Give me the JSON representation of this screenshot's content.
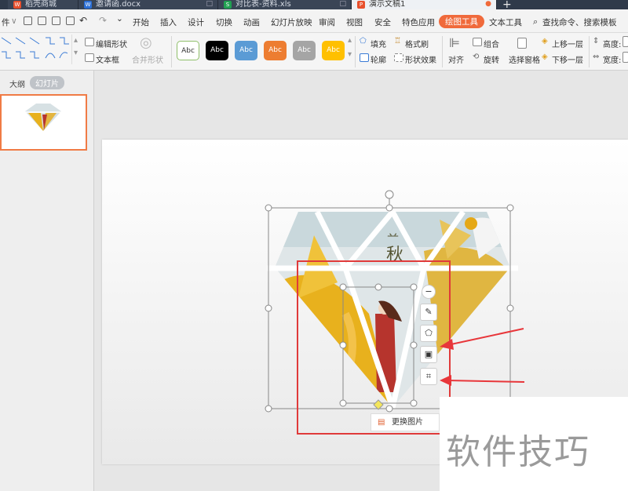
{
  "tabs": [
    {
      "label": "稻壳商城",
      "color": "#e8502d"
    },
    {
      "label": "邀请函.docx",
      "color": "#2b6fd6"
    },
    {
      "label": "对比表-资料.xls",
      "color": "#21a152"
    },
    {
      "label": "演示文稿1",
      "color": "#e8502d"
    }
  ],
  "menu": {
    "file": "件",
    "items": [
      "开始",
      "插入",
      "设计",
      "切换",
      "动画",
      "幻灯片放映",
      "审阅",
      "视图",
      "安全",
      "特色应用"
    ],
    "active": "绘图工具",
    "text_tools": "文本工具",
    "search": "查找命令、搜索模板"
  },
  "ribbon": {
    "edit_shape": "编辑形状",
    "text_box": "文本框",
    "merge_shape": "合并形状",
    "style_label": "Abc",
    "fill": "填充",
    "format_brush": "格式刷",
    "outline": "轮廓",
    "shape_effects": "形状效果",
    "align": "对齐",
    "group": "组合",
    "rotate": "旋转",
    "selection_pane": "选择窗格",
    "bring_forward": "上移一层",
    "send_backward": "下移一层",
    "height": "高度:",
    "width": "宽度:"
  },
  "panel": {
    "outline_tab": "大纲",
    "slides_tab": "幻灯片"
  },
  "slide": {
    "art_text": "秋"
  },
  "context": {
    "replace_image": "更换图片"
  },
  "watermark": "软件技巧",
  "colors": {
    "accent": "#f06a3b",
    "highlight_box": "#e03a3a",
    "arrow": "#e8363a"
  }
}
